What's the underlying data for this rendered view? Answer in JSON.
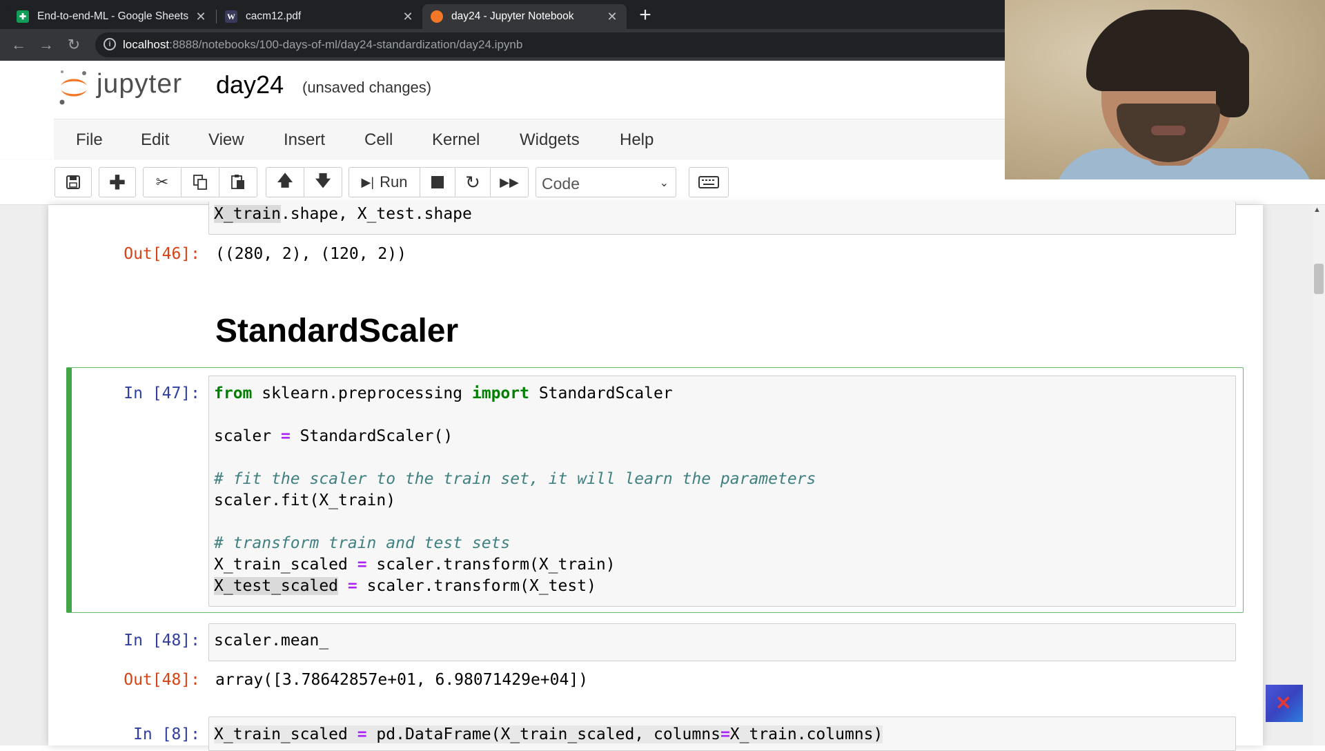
{
  "browser": {
    "tabs": [
      {
        "title": "End-to-end-ML - Google Sheets",
        "favicon": "sheets-icon",
        "active": false
      },
      {
        "title": "cacm12.pdf",
        "favicon": "W",
        "active": false
      },
      {
        "title": "day24 - Jupyter Notebook",
        "favicon": "jupyter-icon",
        "active": true
      }
    ],
    "url_host": "localhost",
    "url_rest": ":8888/notebooks/100-days-of-ml/day24-standardization/day24.ipynb"
  },
  "jupyter": {
    "logo_text": "jupyter",
    "notebook_name": "day24",
    "status": "(unsaved changes)",
    "menu": [
      "File",
      "Edit",
      "View",
      "Insert",
      "Cell",
      "Kernel",
      "Widgets",
      "Help"
    ],
    "toolbar": {
      "run_label": "Run",
      "cell_type": "Code"
    }
  },
  "cells": {
    "c46": {
      "input_first": "X_train",
      "input_rest": ".shape, X_test.shape",
      "out_prompt": "Out[46]:",
      "output": "((280, 2), (120, 2))"
    },
    "markdown_title": "StandardScaler",
    "c47": {
      "prompt": "In [47]:",
      "l1_kw1": "from",
      "l1_mod": " sklearn.preprocessing ",
      "l1_kw2": "import",
      "l1_name": " StandardScaler",
      "l2_a": "scaler ",
      "l2_op": "=",
      "l2_b": " StandardScaler()",
      "l3_comment": "# fit the scaler to the train set, it will learn the parameters",
      "l4": "scaler.fit(X_train)",
      "l5_comment": "# transform train and test sets",
      "l6_a": "X_train_scaled ",
      "l6_op": "=",
      "l6_b": " scaler.transform(X_train)",
      "l7_a": "X_test_scaled",
      "l7_sp": " ",
      "l7_op": "=",
      "l7_b": " scaler.transform(X_test)"
    },
    "c48": {
      "prompt": "In [48]:",
      "input": "scaler.mean_",
      "out_prompt": "Out[48]:",
      "output": "array([3.78642857e+01, 6.98071429e+04])"
    },
    "c8": {
      "prompt": "In [8]:",
      "a": "X_train_scaled ",
      "op1": "=",
      "b": " pd.DataFrame(X_train_scaled, columns",
      "op2": "=",
      "c": "X_train.columns)"
    }
  }
}
